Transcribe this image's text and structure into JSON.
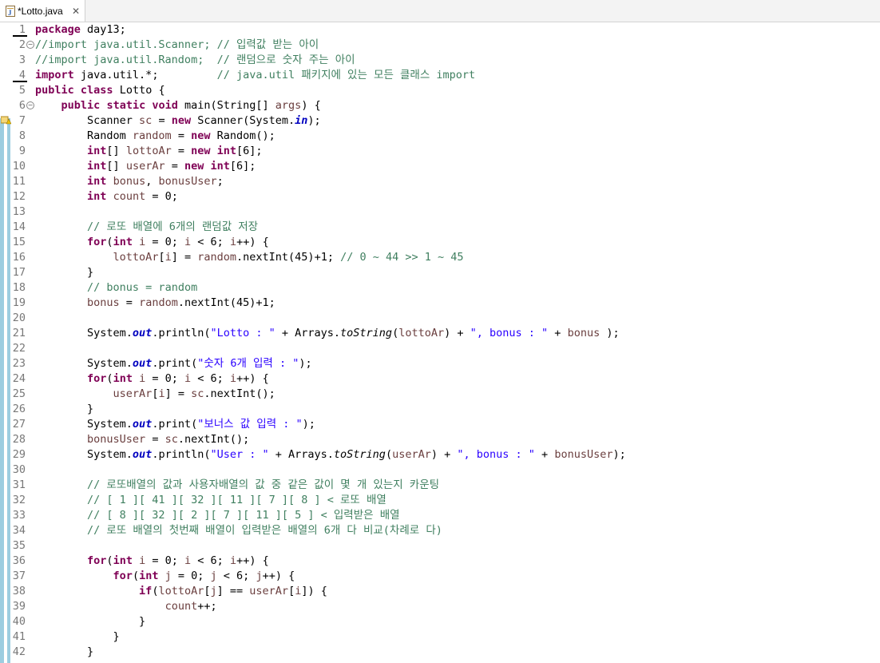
{
  "tab": {
    "label": "*Lotto.java",
    "close": "✕"
  },
  "lines": [
    "<span class='kw'>package</span> day13;",
    "<span class='cm'>//import java.util.Scanner; // 입력값 받는 아이</span>",
    "<span class='cm'>//import java.util.Random;  // 랜덤으로 숫자 주는 아이</span>",
    "<span class='kw'>import</span> java.util.*;         <span class='cm'>// java.util 패키지에 있는 모든 클래스 import</span>",
    "<span class='kw'>public</span> <span class='kw'>class</span> Lotto {",
    "    <span class='kw'>public</span> <span class='kw'>static</span> <span class='kw'>void</span> main(String[] <span class='vr'>args</span>) {",
    "        Scanner <span class='vr'>sc</span> = <span class='kw'>new</span> Scanner(System.<span class='fd'>in</span>);",
    "        Random <span class='vr'>random</span> = <span class='kw'>new</span> Random();",
    "        <span class='kw'>int</span>[] <span class='vr'>lottoAr</span> = <span class='kw'>new</span> <span class='kw'>int</span>[6];",
    "        <span class='kw'>int</span>[] <span class='vr'>userAr</span> = <span class='kw'>new</span> <span class='kw'>int</span>[6];",
    "        <span class='kw'>int</span> <span class='vr'>bonus</span>, <span class='vr'>bonusUser</span>;",
    "        <span class='kw'>int</span> <span class='vr'>count</span> = 0;",
    "",
    "        <span class='cm'>// 로또 배열에 6개의 랜덤값 저장</span>",
    "        <span class='kw'>for</span>(<span class='kw'>int</span> <span class='vr'>i</span> = 0; <span class='vr'>i</span> &lt; 6; <span class='vr'>i</span>++) {",
    "            <span class='vr'>lottoAr</span>[<span class='vr'>i</span>] = <span class='vr'>random</span>.nextInt(45)+1; <span class='cm'>// 0 ~ 44 &gt;&gt; 1 ~ 45</span>",
    "        }",
    "        <span class='cm'>// bonus = random</span>",
    "        <span class='vr'>bonus</span> = <span class='vr'>random</span>.nextInt(45)+1;",
    "",
    "        System.<span class='fd'>out</span>.println(<span class='st'>\"Lotto : \"</span> + Arrays.<span class='it'>toString</span>(<span class='vr'>lottoAr</span>) + <span class='st'>\", bonus : \"</span> + <span class='vr'>bonus</span> );",
    "",
    "        System.<span class='fd'>out</span>.print(<span class='st'>\"숫자 6개 입력 : \"</span>);",
    "        <span class='kw'>for</span>(<span class='kw'>int</span> <span class='vr'>i</span> = 0; <span class='vr'>i</span> &lt; 6; <span class='vr'>i</span>++) {",
    "            <span class='vr'>userAr</span>[<span class='vr'>i</span>] = <span class='vr'>sc</span>.nextInt();",
    "        }",
    "        System.<span class='fd'>out</span>.print(<span class='st'>\"보너스 값 입력 : \"</span>);",
    "        <span class='vr'>bonusUser</span> = <span class='vr'>sc</span>.nextInt();",
    "        System.<span class='fd'>out</span>.println(<span class='st'>\"User : \"</span> + Arrays.<span class='it'>toString</span>(<span class='vr'>userAr</span>) + <span class='st'>\", bonus : \"</span> + <span class='vr'>bonusUser</span>);",
    "",
    "        <span class='cm'>// 로또배열의 값과 사용자배열의 값 중 같은 값이 몇 개 있는지 카운팅</span>",
    "        <span class='cm'>// [ 1 ][ 41 ][ 32 ][ 11 ][ 7 ][ 8 ] &lt; 로또 배열</span>",
    "        <span class='cm'>// [ 8 ][ 32 ][ 2 ][ 7 ][ 11 ][ 5 ] &lt; 입력받은 배열</span>",
    "        <span class='cm'>// 로또 배열의 첫번째 배열이 입력받은 배열의 6개 다 비교(차례로 다)</span>",
    "",
    "        <span class='kw'>for</span>(<span class='kw'>int</span> <span class='vr'>i</span> = 0; <span class='vr'>i</span> &lt; 6; <span class='vr'>i</span>++) {",
    "            <span class='kw'>for</span>(<span class='kw'>int</span> <span class='vr'>j</span> = 0; <span class='vr'>j</span> &lt; 6; <span class='vr'>j</span>++) {",
    "                <span class='kw'>if</span>(<span class='vr'>lottoAr</span>[<span class='vr'>j</span>] == <span class='vr'>userAr</span>[<span class='vr'>i</span>]) {",
    "                    <span class='vr'>count</span>++;",
    "                }",
    "            }",
    "        }"
  ],
  "fold_markers": [
    2,
    6
  ],
  "warning_line": 7
}
